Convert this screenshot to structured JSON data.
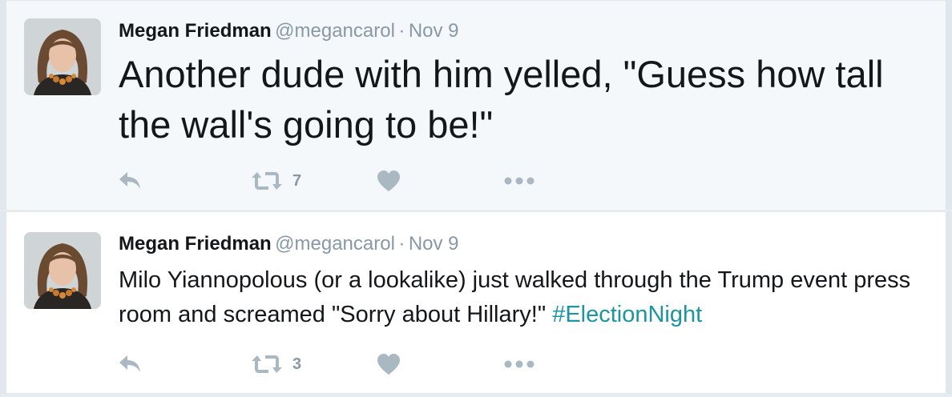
{
  "colors": {
    "background": "#e6ecf0",
    "highlight_bg": "#f5f8fa",
    "text": "#14171a",
    "muted": "#8899a6",
    "icon": "#aab8c2",
    "hashtag": "#1b95a0"
  },
  "tweets": [
    {
      "name": "Megan Friedman",
      "handle": "@megancarol",
      "separator": "·",
      "date": "Nov 9",
      "text": "Another dude with him yelled, \"Guess how tall the wall's going to be!\"",
      "hashtag": "",
      "retweets": "7",
      "icons": [
        "reply-icon",
        "retweet-icon",
        "heart-icon",
        "more-icon"
      ]
    },
    {
      "name": "Megan Friedman",
      "handle": "@megancarol",
      "separator": "·",
      "date": "Nov 9",
      "text": "Milo Yiannopolous (or a lookalike) just walked through the Trump event press room and screamed \"Sorry about Hillary!\" ",
      "hashtag": "#ElectionNight",
      "retweets": "3",
      "icons": [
        "reply-icon",
        "retweet-icon",
        "heart-icon",
        "more-icon"
      ]
    }
  ]
}
